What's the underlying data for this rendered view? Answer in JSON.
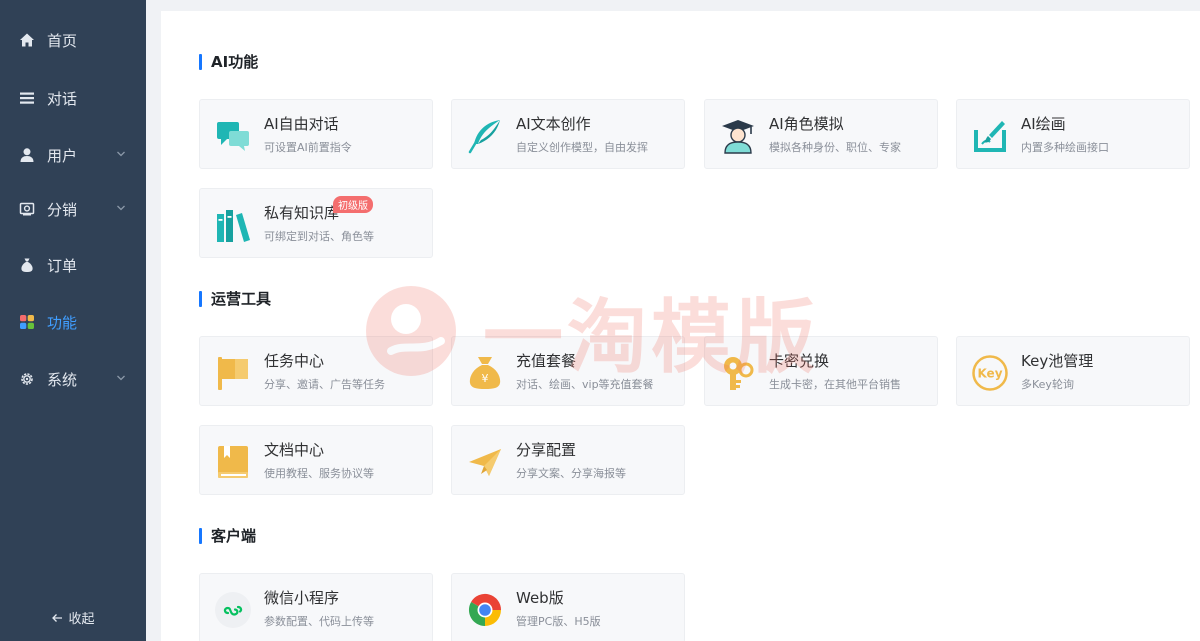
{
  "sidebar": {
    "items": [
      {
        "label": "首页",
        "icon": "home-icon"
      },
      {
        "label": "对话",
        "icon": "list-icon"
      },
      {
        "label": "用户",
        "icon": "user-icon"
      },
      {
        "label": "分销",
        "icon": "distribution-icon"
      },
      {
        "label": "订单",
        "icon": "money-bag-icon"
      },
      {
        "label": "功能",
        "icon": "grid-icon",
        "active": true
      },
      {
        "label": "系统",
        "icon": "gear-icon"
      }
    ],
    "collapse_label": "收起"
  },
  "sections": {
    "ai": {
      "title": "AI功能",
      "cards": [
        {
          "title": "AI自由对话",
          "desc": "可设置AI前置指令",
          "icon": "chat-bubbles-icon"
        },
        {
          "title": "AI文本创作",
          "desc": "自定义创作模型，自由发挥",
          "icon": "feather-icon"
        },
        {
          "title": "AI角色模拟",
          "desc": "模拟各种身份、职位、专家",
          "icon": "graduate-icon"
        },
        {
          "title": "AI绘画",
          "desc": "内置多种绘画接口",
          "icon": "paint-brush-icon"
        },
        {
          "title": "私有知识库",
          "desc": "可绑定到对话、角色等",
          "icon": "books-icon",
          "badge": "初级版"
        }
      ]
    },
    "ops": {
      "title": "运营工具",
      "cards": [
        {
          "title": "任务中心",
          "desc": "分享、邀请、广告等任务",
          "icon": "flag-icon"
        },
        {
          "title": "充值套餐",
          "desc": "对话、绘画、vip等充值套餐",
          "icon": "money-bag-icon"
        },
        {
          "title": "卡密兑换",
          "desc": "生成卡密，在其他平台销售",
          "icon": "key-icon"
        },
        {
          "title": "Key池管理",
          "desc": "多Key轮询",
          "icon": "key-circle-icon"
        },
        {
          "title": "文档中心",
          "desc": "使用教程、服务协议等",
          "icon": "book-icon"
        },
        {
          "title": "分享配置",
          "desc": "分享文案、分享海报等",
          "icon": "paper-plane-icon"
        }
      ]
    },
    "client": {
      "title": "客户端",
      "cards": [
        {
          "title": "微信小程序",
          "desc": "参数配置、代码上传等",
          "icon": "mini-program-icon"
        },
        {
          "title": "Web版",
          "desc": "管理PC版、H5版",
          "icon": "chrome-icon"
        }
      ]
    }
  },
  "watermark": {
    "text": "一淘模版"
  },
  "colors": {
    "sidebar_bg": "#304156",
    "accent": "#409eff",
    "section_bar": "#1677ff",
    "teal": "#1fb6b4",
    "gold": "#f0b94a",
    "badge": "#f46e6e"
  }
}
